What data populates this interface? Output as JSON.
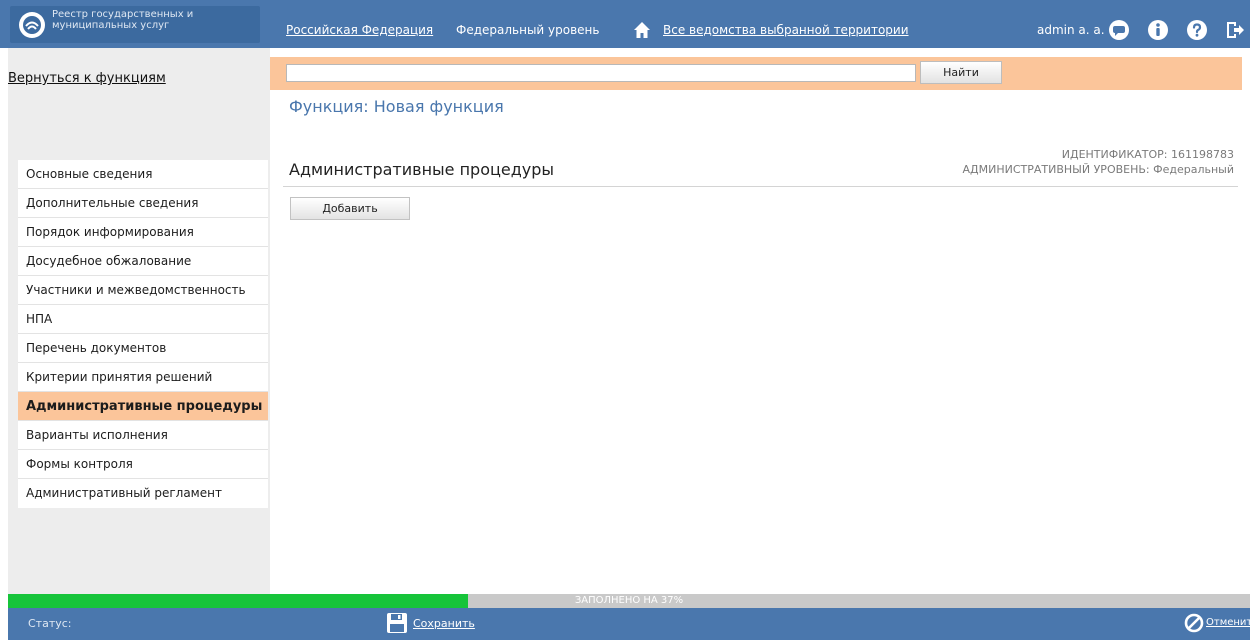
{
  "brand": {
    "title": "Реестр государственных и муниципальных услуг"
  },
  "topbar": {
    "territory": "Российская Федерация",
    "level": "Федеральный уровень",
    "departments": "Все ведомства выбранной территории",
    "user": "admin a. a."
  },
  "sidebar": {
    "back_label": "Вернуться к функциям",
    "items": [
      {
        "label": "Основные сведения",
        "active": false
      },
      {
        "label": "Дополнительные сведения",
        "active": false
      },
      {
        "label": "Порядок информирования",
        "active": false
      },
      {
        "label": "Досудебное обжалование",
        "active": false
      },
      {
        "label": "Участники и межведомственность",
        "active": false
      },
      {
        "label": "НПА",
        "active": false
      },
      {
        "label": "Перечень документов",
        "active": false
      },
      {
        "label": "Критерии принятия решений",
        "active": false
      },
      {
        "label": "Административные процедуры",
        "active": true
      },
      {
        "label": "Варианты исполнения",
        "active": false
      },
      {
        "label": "Формы контроля",
        "active": false
      },
      {
        "label": "Административный регламент",
        "active": false
      }
    ]
  },
  "search": {
    "value": "",
    "button_label": "Найти"
  },
  "main": {
    "page_title": "Функция: Новая функция",
    "section_title": "Административные процедуры",
    "identifier": "ИДЕНТИФИКАТОР: 161198783",
    "admin_level": "АДМИНИСТРАТИВНЫЙ УРОВЕНЬ: Федеральный",
    "add_label": "Добавить"
  },
  "progress": {
    "label": "ЗАПОЛНЕНО НА 37%",
    "percent": 37
  },
  "footer": {
    "status_label": "Статус:",
    "save_label": "Сохранить",
    "cancel_label": "Отменить"
  },
  "colors": {
    "header_blue": "#4a77ad",
    "accent_orange": "#fbc59a",
    "progress_green": "#16c43a",
    "progress_track": "#c9c9c9"
  },
  "icons": [
    "brand-logo-icon",
    "home-icon",
    "chat-icon",
    "info-icon",
    "help-icon",
    "logout-icon",
    "save-icon",
    "cancel-icon"
  ]
}
